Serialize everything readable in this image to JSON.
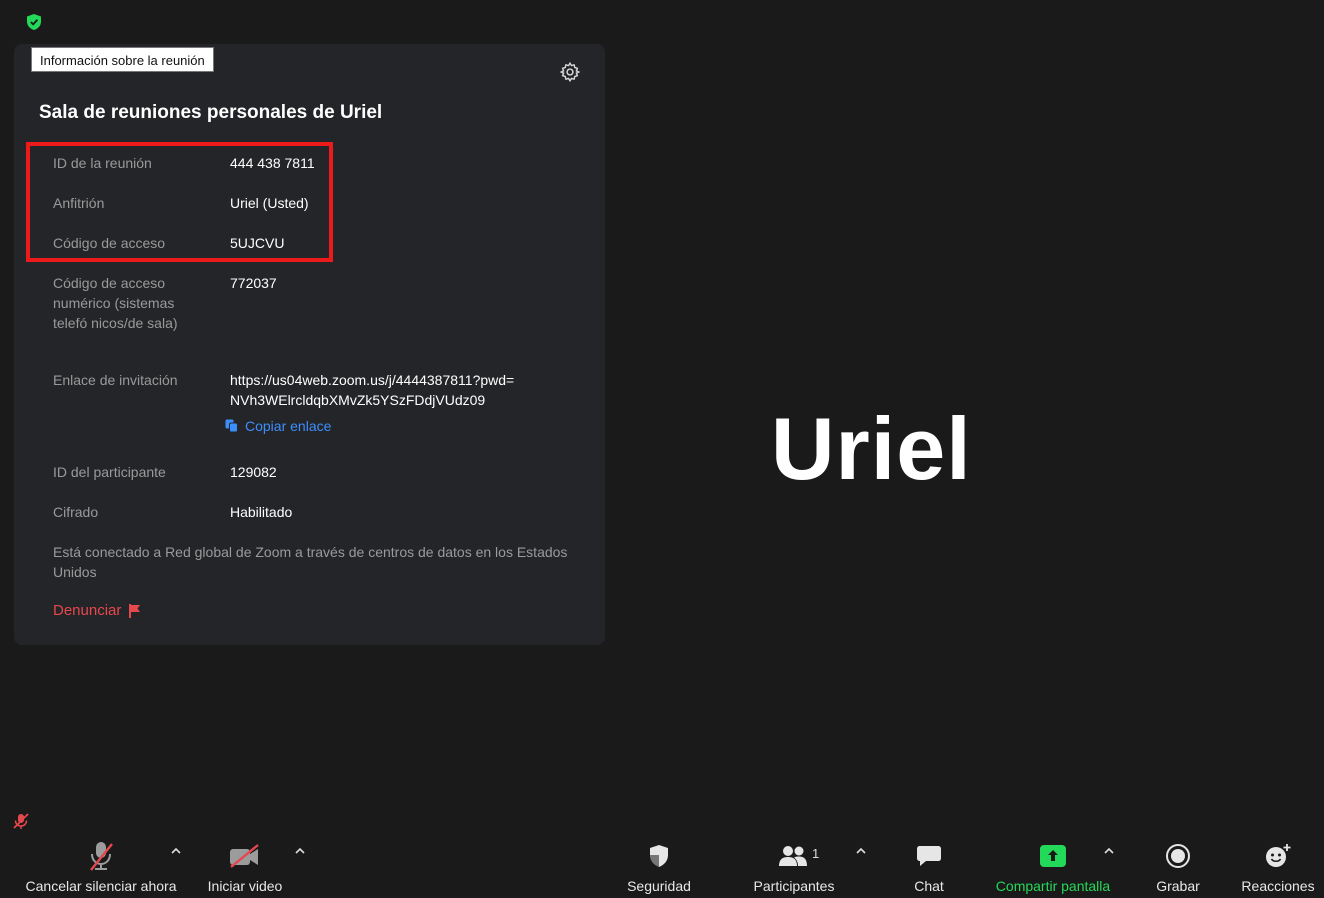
{
  "tooltip": "Información sobre la reunión",
  "panel": {
    "title": "Sala de reuniones personales de Uriel",
    "rows": [
      {
        "label": "ID de la reunión",
        "value": "444 438 7811"
      },
      {
        "label": "Anfitrión",
        "value": "Uriel (Usted)"
      },
      {
        "label": "Código de acceso",
        "value": "5UJCVU"
      },
      {
        "label": "Código de acceso numérico (sistemas telefó nicos/de sala)",
        "value": "772037"
      },
      {
        "label": "Enlace de invitación",
        "value_line1": "https://us04web.zoom.us/j/4444387811?pwd=",
        "value_line2": "NVh3WElrcldqbXMvZk5YSzFDdjVUdz09"
      },
      {
        "label": "ID del participante",
        "value": "129082"
      },
      {
        "label": "Cifrado",
        "value": "Habilitado"
      }
    ],
    "copy_link": "Copiar enlace",
    "connection": "Está conectado a Red global de Zoom a través de centros de datos en los Estados Unidos",
    "report": "Denunciar"
  },
  "video": {
    "name": "Uriel"
  },
  "toolbar": {
    "mute": "Cancelar silenciar ahora",
    "video": "Iniciar video",
    "security": "Seguridad",
    "participants": "Participantes",
    "participants_count": "1",
    "chat": "Chat",
    "share": "Compartir pantalla",
    "record": "Grabar",
    "reactions": "Reacciones"
  },
  "colors": {
    "background": "#1a1a1a",
    "panel": "#242528",
    "accent_green": "#23d959",
    "link_blue": "#3d8efd",
    "alert_red": "#e5484d",
    "highlight_red": "#ec1a1a"
  }
}
